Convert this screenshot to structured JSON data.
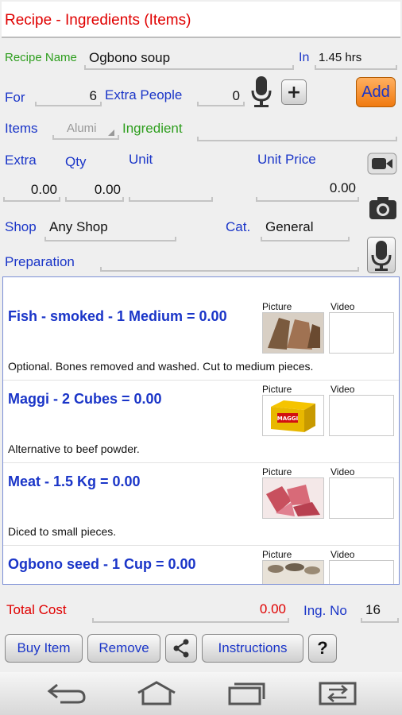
{
  "header": {
    "title": "Recipe - Ingredients (Items)"
  },
  "recipe": {
    "name_label": "Recipe Name",
    "name_value": "Ogbono soup",
    "in_label": "In",
    "in_value": "1.45 hrs"
  },
  "people": {
    "for_label": "For",
    "for_value": "6",
    "extra_label": "Extra People",
    "extra_value": "0",
    "add_label": "Add",
    "plus_label": "+"
  },
  "items_row": {
    "items_label": "Items",
    "items_value": "Alumi",
    "ingredient_label": "Ingredient"
  },
  "costs": {
    "extra_label": "Extra",
    "qty_label": "Qty",
    "unit_label": "Unit",
    "unit_price_label": "Unit Price",
    "extra_value": "0.00",
    "qty_value": "0.00",
    "unit_value": "",
    "unit_price_value": "0.00"
  },
  "shop": {
    "shop_label": "Shop",
    "shop_value": "Any Shop",
    "cat_label": "Cat.",
    "cat_value": "General"
  },
  "preparation": {
    "label": "Preparation",
    "value": ""
  },
  "media_labels": {
    "picture": "Picture",
    "video": "Video"
  },
  "ingredients": [
    {
      "title": "Fish - smoked - 1 Medium = 0.00",
      "note": "Optional. Bones removed and washed. Cut to medium pieces."
    },
    {
      "title": "Maggi - 2 Cubes = 0.00",
      "note": "Alternative to beef powder.",
      "logo": "MAGGI"
    },
    {
      "title": "Meat - 1.5 Kg = 0.00",
      "note": "Diced to small pieces."
    },
    {
      "title": "Ogbono seed - 1 Cup = 0.00",
      "note": ""
    }
  ],
  "totals": {
    "total_label": "Total Cost",
    "total_value": "0.00",
    "ing_no_label": "Ing. No",
    "ing_no_value": "16"
  },
  "buttons": {
    "buy": "Buy Item",
    "remove": "Remove",
    "instructions": "Instructions",
    "help": "?"
  },
  "colors": {
    "title_red": "#e00000",
    "label_blue": "#1a35c8",
    "label_green": "#2e9e1e",
    "add_orange": "#f07a10"
  }
}
